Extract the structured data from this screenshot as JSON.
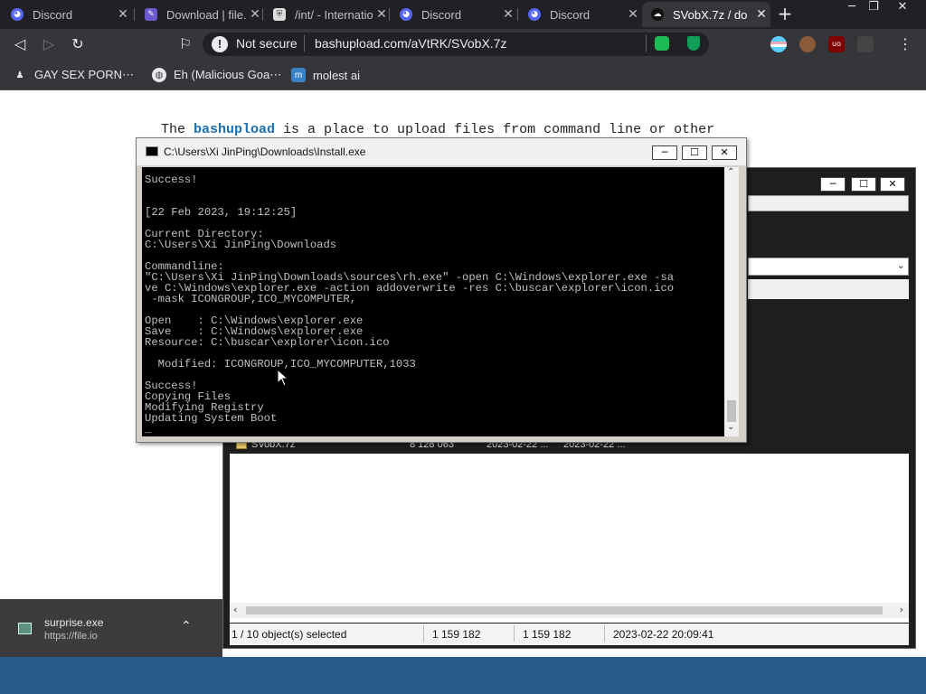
{
  "browser": {
    "tabs": [
      {
        "label": "Discord",
        "icon": "discord-icon"
      },
      {
        "label": "Download | file.io",
        "icon": "file-io-icon"
      },
      {
        "label": "/int/ - International",
        "icon": "shield-icon"
      },
      {
        "label": "Discord",
        "icon": "discord-icon"
      },
      {
        "label": "Discord",
        "icon": "discord-icon"
      },
      {
        "label": "SVobX.7z / do",
        "icon": "cloud-icon",
        "active": true
      }
    ],
    "not_secure": "Not secure",
    "url": "bashupload.com/aVtRK/SVobX.7z",
    "bookmarks": [
      {
        "label": "GAY SEX PORN⋯"
      },
      {
        "label": "Eh (Malicious Goa⋯"
      },
      {
        "label": "molest ai"
      }
    ]
  },
  "page": {
    "line_prefix": "The ",
    "link": "bashupload",
    "line_suffix": " is a place to upload files from command line or other"
  },
  "cmd": {
    "title": "C:\\Users\\Xi JinPing\\Downloads\\Install.exe",
    "output": "Success!\n\n\n[22 Feb 2023, 19:12:25]\n\nCurrent Directory:\nC:\\Users\\Xi JinPing\\Downloads\n\nCommandline:\n\"C:\\Users\\Xi JinPing\\Downloads\\sources\\rh.exe\" -open C:\\Windows\\explorer.exe -sa\nve C:\\Windows\\explorer.exe -action addoverwrite -res C:\\buscar\\explorer\\icon.ico\n -mask ICONGROUP,ICO_MYCOMPUTER,\n\nOpen    : C:\\Windows\\explorer.exe\nSave    : C:\\Windows\\explorer.exe\nResource: C:\\buscar\\explorer\\icon.ico\n\n  Modified: ICONGROUP,ICO_MYCOMPUTER,1033\n\nSuccess!\nCopying Files\nModifying Registry\nUpdating System Boot\n_"
  },
  "filemanager": {
    "row": {
      "name": "SVobX.7z",
      "size": "8 128 063",
      "modified": "2023-02-22 ...",
      "created": "2023-02-22 ..."
    },
    "status": {
      "selected": "1 / 10 object(s) selected",
      "size": "1 159 182",
      "packed": "1 159 182",
      "date": "2023-02-22 20:09:41"
    }
  },
  "download": {
    "filename": "surprise.exe",
    "source": "https://file.io"
  }
}
